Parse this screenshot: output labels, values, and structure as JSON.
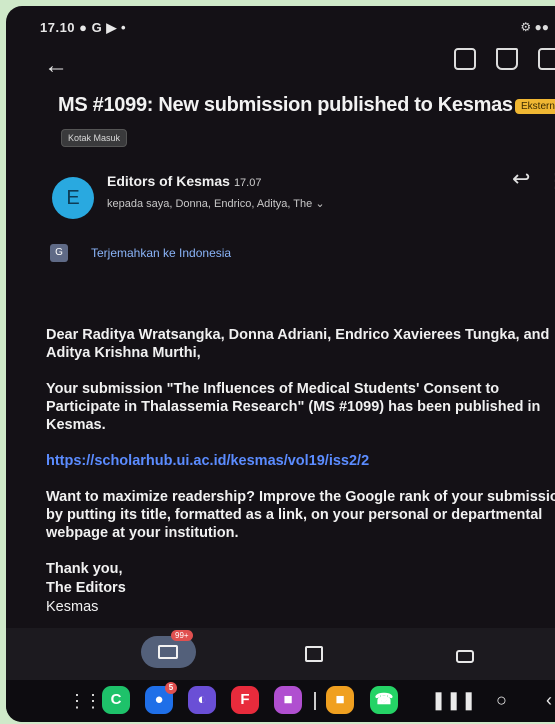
{
  "status_bar": {
    "time": "17.10",
    "indicators": "● G ▶ •",
    "right_icons": "⚙ ●●"
  },
  "toolbar": {
    "back_icon": "arrow-left-icon",
    "archive_icon": "archive-icon",
    "delete_icon": "trash-icon",
    "mail_icon": "mail-icon"
  },
  "email": {
    "subject": "MS #1099: New submission published to Kesmas",
    "external_label": "Ekstern",
    "folder_chip": "Kotak Masuk",
    "sender_initial": "E",
    "sender": "Editors of Kesmas",
    "time": "17.07",
    "recipients": "kepada saya, Donna, Endrico, Aditya, The",
    "translate": "Terjemahkan ke Indonesia",
    "body": {
      "greeting": "Dear Raditya Wratsangka, Donna Adriani, Endrico Xavierees Tungka, and Aditya Krishna Murthi,",
      "para1": "Your submission \"The Influences of Medical Students' Consent to Participate in Thalassemia Research\" (MS #1099) has been published in Kesmas.",
      "link": "https://scholarhub.ui.ac.id/kesmas/vol19/iss2/2",
      "para2": "Want to maximize readership? Improve the Google rank of your submission by putting its title, formatted as a link, on your personal or departmental webpage at your institution.",
      "sign1": "Thank you,",
      "sign2": "The Editors",
      "sign3": "Kesmas"
    }
  },
  "bottom_nav": {
    "mail_badge": "99+"
  },
  "dock": {
    "apps": [
      {
        "name": "phone-app",
        "glyph": "C",
        "color": "#1ec26a"
      },
      {
        "name": "messages-app",
        "glyph": "●",
        "color": "#1f6fe8",
        "badge": "5"
      },
      {
        "name": "internet-app",
        "glyph": "◐",
        "color": "#6a4fd6"
      },
      {
        "name": "flipboard-app",
        "glyph": "F",
        "color": "#e82b3c"
      },
      {
        "name": "gallery-app",
        "glyph": "■",
        "color": "#b04fd0"
      },
      {
        "name": "files-app",
        "glyph": "■",
        "color": "#f0a020"
      },
      {
        "name": "whatsapp-app",
        "glyph": "☎",
        "color": "#25d366"
      }
    ]
  }
}
